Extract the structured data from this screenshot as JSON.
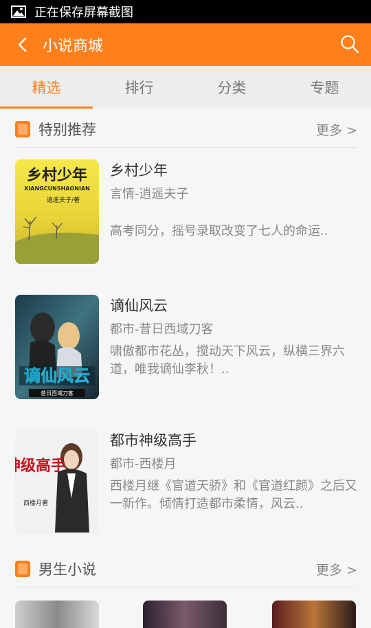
{
  "status": {
    "text": "正在保存屏幕截图"
  },
  "header": {
    "title": "小说商城"
  },
  "tabs": [
    {
      "label": "精选"
    },
    {
      "label": "排行"
    },
    {
      "label": "分类"
    },
    {
      "label": "专题"
    }
  ],
  "sections": [
    {
      "title": "特别推荐",
      "more": "更多 >",
      "books": [
        {
          "name": "乡村少年",
          "meta": "言情-逍遥夫子",
          "desc": "高考同分，摇号录取改变了七人的命运..",
          "cover_title": "乡村少年",
          "cover_sub": "XIANGCUNSHAONIAN",
          "cover_author": "逍遥夫子/著"
        },
        {
          "name": "谪仙风云",
          "meta": "都市-昔日西域刀客",
          "desc": "啸傲都市花丛，搅动天下风云，纵横三界六道，唯我谪仙李秋！..",
          "cover_title": "谪仙风云",
          "cover_author": "昔日西域刀客"
        },
        {
          "name": "都市神级高手",
          "meta": "都市-西楼月",
          "desc": "西楼月继《官道天骄》和《官道红颜》之后又一新作。倾情打造都市柔情，风云..",
          "cover_title": "神级高手",
          "cover_author": "西楼月著"
        }
      ]
    },
    {
      "title": "男生小说",
      "more": "更多 >"
    }
  ]
}
